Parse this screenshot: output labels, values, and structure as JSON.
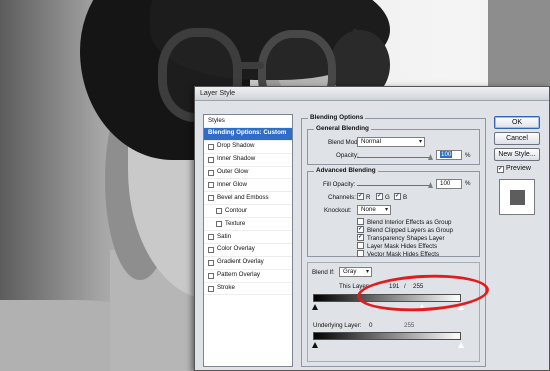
{
  "dialog": {
    "title": "Layer Style"
  },
  "styles_list": {
    "heading": "Styles",
    "items": [
      {
        "label": "Blending Options: Custom",
        "active": true,
        "checkbox": false,
        "sub": false
      },
      {
        "label": "Drop Shadow",
        "active": false,
        "checkbox": true,
        "sub": false
      },
      {
        "label": "Inner Shadow",
        "active": false,
        "checkbox": true,
        "sub": false
      },
      {
        "label": "Outer Glow",
        "active": false,
        "checkbox": true,
        "sub": false
      },
      {
        "label": "Inner Glow",
        "active": false,
        "checkbox": true,
        "sub": false
      },
      {
        "label": "Bevel and Emboss",
        "active": false,
        "checkbox": true,
        "sub": false
      },
      {
        "label": "Contour",
        "active": false,
        "checkbox": true,
        "sub": true
      },
      {
        "label": "Texture",
        "active": false,
        "checkbox": true,
        "sub": true
      },
      {
        "label": "Satin",
        "active": false,
        "checkbox": true,
        "sub": false
      },
      {
        "label": "Color Overlay",
        "active": false,
        "checkbox": true,
        "sub": false
      },
      {
        "label": "Gradient Overlay",
        "active": false,
        "checkbox": true,
        "sub": false
      },
      {
        "label": "Pattern Overlay",
        "active": false,
        "checkbox": true,
        "sub": false
      },
      {
        "label": "Stroke",
        "active": false,
        "checkbox": true,
        "sub": false
      }
    ]
  },
  "blending_options": {
    "title": "Blending Options",
    "general": {
      "title": "General Blending",
      "blend_mode_label": "Blend Mode:",
      "blend_mode_value": "Normal",
      "opacity_label": "Opacity:",
      "opacity_value": "100",
      "opacity_unit": "%",
      "opacity_level": 1.0
    },
    "advanced": {
      "title": "Advanced Blending",
      "fill_opacity_label": "Fill Opacity:",
      "fill_opacity_value": "100",
      "fill_opacity_unit": "%",
      "fill_opacity_level": 1.0,
      "channels_label": "Channels:",
      "channels": [
        {
          "label": "R",
          "checked": true
        },
        {
          "label": "G",
          "checked": true
        },
        {
          "label": "B",
          "checked": true
        }
      ],
      "knockout_label": "Knockout:",
      "knockout_value": "None",
      "options": [
        {
          "label": "Blend Interior Effects as Group",
          "checked": false
        },
        {
          "label": "Blend Clipped Layers as Group",
          "checked": true
        },
        {
          "label": "Transparency Shapes Layer",
          "checked": true
        },
        {
          "label": "Layer Mask Hides Effects",
          "checked": false
        },
        {
          "label": "Vector Mask Hides Effects",
          "checked": false
        }
      ]
    },
    "blend_if": {
      "label": "Blend If:",
      "value": "Gray",
      "this_layer_label": "This Layer:",
      "this_layer_low": "191",
      "this_layer_sep": "/",
      "this_layer_high": "255",
      "underlying_label": "Underlying Layer:",
      "underlying_low": "0",
      "underlying_high": "255"
    }
  },
  "buttons": {
    "ok": "OK",
    "cancel": "Cancel",
    "new_style": "New Style...",
    "preview_label": "Preview",
    "preview_checked": true
  },
  "check_mark": "✓",
  "dropdown_arrow": "▾",
  "colors": {
    "selection": "#2f6dc7",
    "annotation": "#e21c1c",
    "dialog_bg": "#dfe3e8"
  }
}
